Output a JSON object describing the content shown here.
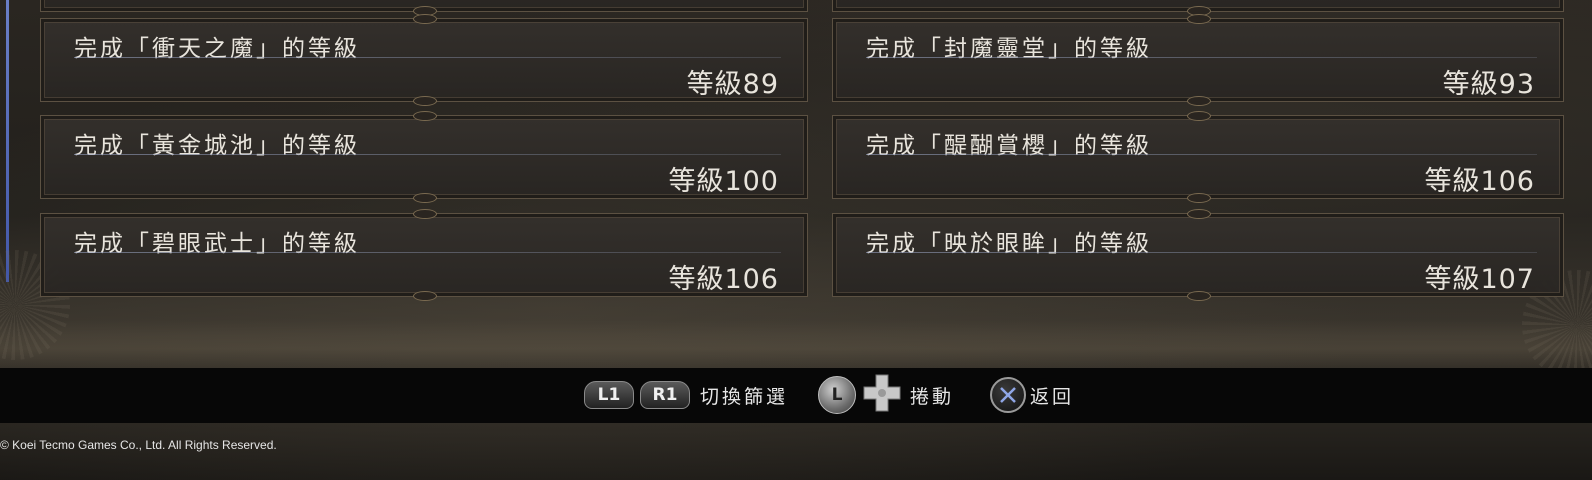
{
  "achievements": {
    "left": [
      {
        "title": "完成「衝天之魔」的等級",
        "level": "等級89"
      },
      {
        "title": "完成「黃金城池」的等級",
        "level": "等級100"
      },
      {
        "title": "完成「碧眼武士」的等級",
        "level": "等級106"
      }
    ],
    "right": [
      {
        "title": "完成「封魔靈堂」的等級",
        "level": "等級93"
      },
      {
        "title": "完成「醍醐賞櫻」的等級",
        "level": "等級106"
      },
      {
        "title": "完成「映於眼眸」的等級",
        "level": "等級107"
      }
    ]
  },
  "controls": {
    "l1_label": "L1",
    "r1_label": "R1",
    "switch_filter": "切換篩選",
    "stick_label": "L",
    "scroll": "捲動",
    "back": "返回"
  },
  "copyright": "© Koei Tecmo Games Co., Ltd. All Rights Reserved.",
  "colors": {
    "text": "#e8e4dc",
    "card_border": "#5c5142",
    "accent_blue": "#4a5fb0"
  },
  "icons": {
    "l1": "l1-button-icon",
    "r1": "r1-button-icon",
    "stick": "left-stick-icon",
    "dpad": "dpad-icon",
    "cross": "cross-button-icon"
  }
}
